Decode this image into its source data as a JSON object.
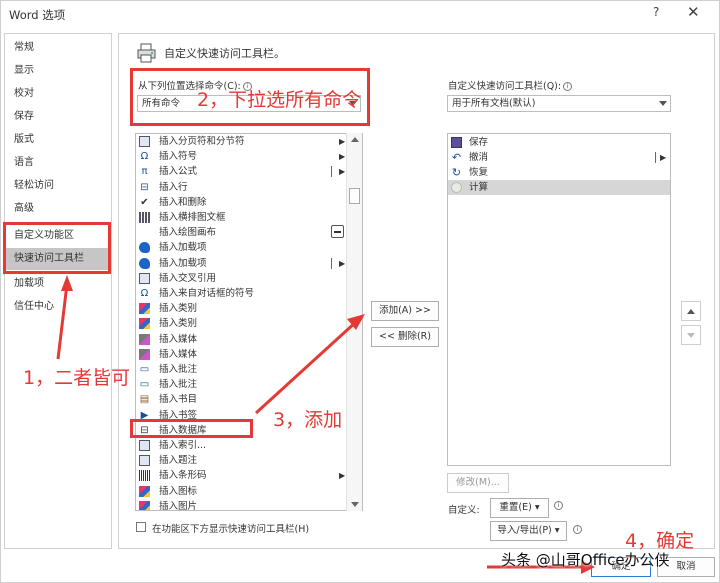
{
  "window": {
    "title": "Word 选项",
    "help": "?",
    "close": "✕"
  },
  "nav": {
    "items": [
      {
        "label": "常规"
      },
      {
        "label": "显示"
      },
      {
        "label": "校对"
      },
      {
        "label": "保存"
      },
      {
        "label": "版式"
      },
      {
        "label": "语言"
      },
      {
        "label": "轻松访问"
      },
      {
        "label": "高级"
      },
      {
        "label": "自定义功能区"
      },
      {
        "label": "快速访问工具栏",
        "selected": true
      },
      {
        "label": "加载项"
      },
      {
        "label": "信任中心"
      }
    ]
  },
  "header": {
    "title": "自定义快速访问工具栏。"
  },
  "left": {
    "choose_label": "从下列位置选择命令(C):",
    "choose_value": "所有命令",
    "commands": [
      {
        "label": "插入分页符和分节符",
        "icon": "page-break-icon",
        "sub": true
      },
      {
        "label": "插入符号",
        "icon": "omega-icon",
        "sub": true
      },
      {
        "label": "插入公式",
        "icon": "pi-icon",
        "split": true
      },
      {
        "label": "插入行",
        "icon": "insert-row-icon"
      },
      {
        "label": "插入和删除",
        "icon": "check-icon"
      },
      {
        "label": "插入横排图文框",
        "icon": "textframe-icon"
      },
      {
        "label": "插入绘图画布",
        "icon": "canvas-icon",
        "mini": true
      },
      {
        "label": "插入加载项",
        "icon": "addin-icon"
      },
      {
        "label": "插入加载项",
        "icon": "addin-icon",
        "split": true
      },
      {
        "label": "插入交叉引用",
        "icon": "crossref-icon"
      },
      {
        "label": "插入来自对话框的符号",
        "icon": "omega-icon"
      },
      {
        "label": "插入类别",
        "icon": "category-icon"
      },
      {
        "label": "插入类别",
        "icon": "category-icon"
      },
      {
        "label": "插入媒体",
        "icon": "media-icon"
      },
      {
        "label": "插入媒体",
        "icon": "media-icon"
      },
      {
        "label": "插入批注",
        "icon": "comment-icon"
      },
      {
        "label": "插入批注",
        "icon": "comment-icon"
      },
      {
        "label": "插入书目",
        "icon": "bibliography-icon"
      },
      {
        "label": "插入书签",
        "icon": "bookmark-icon"
      },
      {
        "label": "插入数据库",
        "icon": "database-icon"
      },
      {
        "label": "插入索引...",
        "icon": "index-icon"
      },
      {
        "label": "插入题注",
        "icon": "caption-icon"
      },
      {
        "label": "插入条形码",
        "icon": "barcode-icon",
        "sub": true
      },
      {
        "label": "插入图标",
        "icon": "icons-icon"
      },
      {
        "label": "插入图片",
        "icon": "picture-icon"
      }
    ],
    "show_below_label": "在功能区下方显示快速访问工具栏(H)"
  },
  "middle": {
    "add_label": "添加(A) >>",
    "remove_label": "<< 删除(R)"
  },
  "right": {
    "customize_label": "自定义快速访问工具栏(Q):",
    "for_value": "用于所有文档(默认)",
    "items": [
      {
        "label": "保存",
        "icon": "save-icon"
      },
      {
        "label": "撤消",
        "icon": "undo-icon",
        "split": true
      },
      {
        "label": "恢复",
        "icon": "redo-icon"
      },
      {
        "label": "计算",
        "icon": "calculate-icon",
        "selected": true
      }
    ],
    "modify_label": "修改(M)...",
    "customize_prefix": "自定义:",
    "reset_label": "重置(E) ▾",
    "import_export_label": "导入/导出(P) ▾",
    "ok_label": "确定",
    "cancel_label": "取消"
  },
  "annotations": {
    "step1": "1，二者皆可",
    "step2": "2，下拉选所有命令",
    "step3": "3，添加",
    "step4": "4，确定",
    "color": "#e53935"
  },
  "watermark": "头条 @山哥Office办公侠"
}
